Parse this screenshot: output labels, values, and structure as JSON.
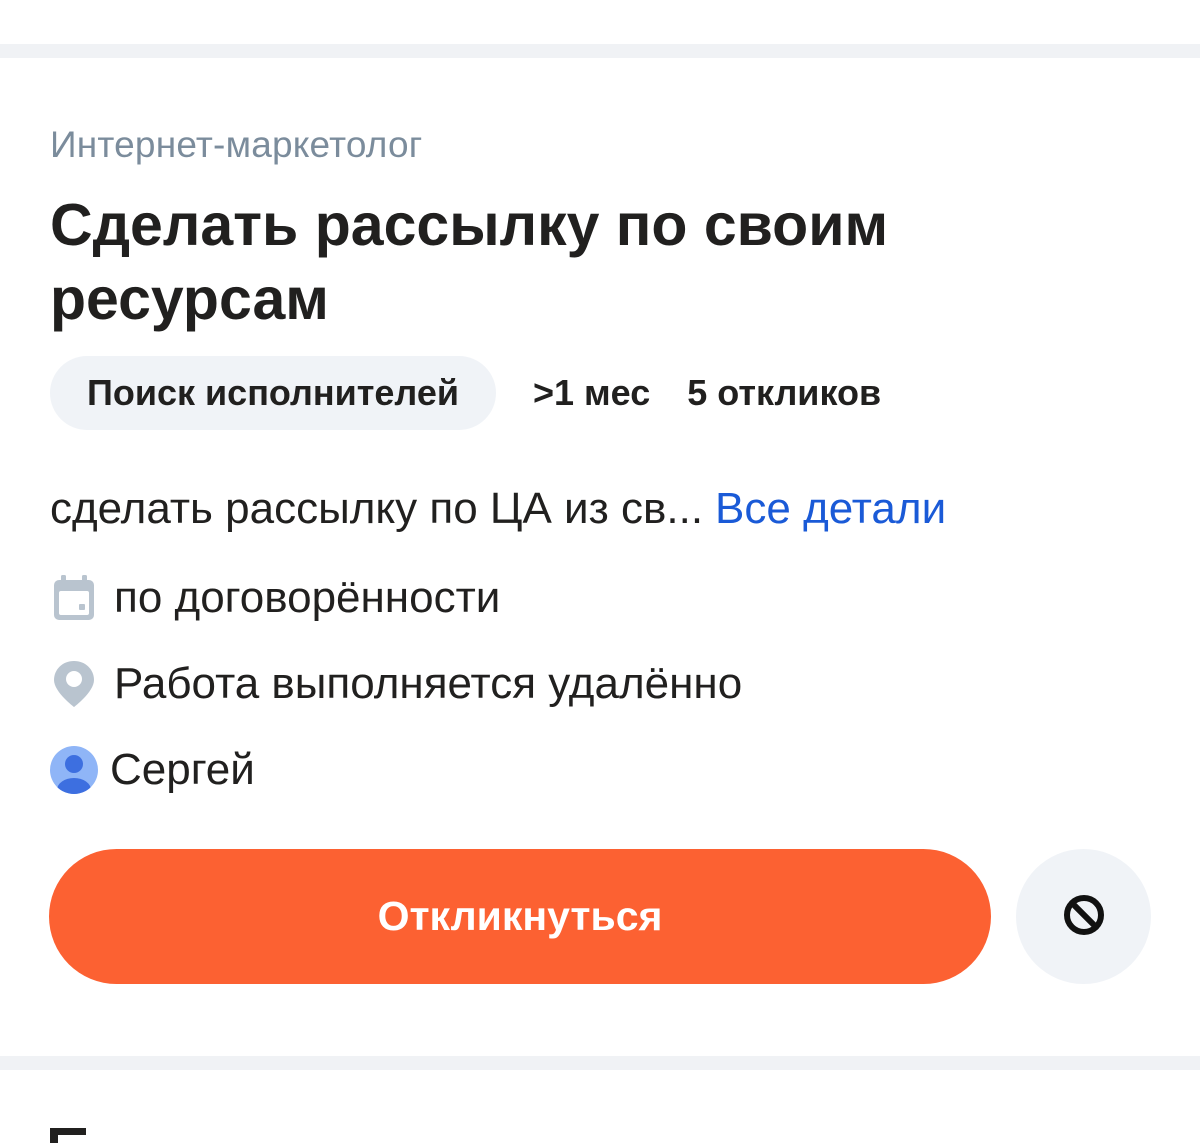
{
  "task": {
    "category": "Интернет-маркетолог",
    "title": "Сделать рассылку по своим ресурсам",
    "status": "Поиск исполнителей",
    "duration": ">1 мес",
    "responses": "5 откликов",
    "description_preview": "сделать рассылку по ЦА из св...",
    "details_link": "Все детали",
    "date": "по договорённости",
    "location": "Работа выполняется удалённо",
    "author": "Сергей"
  },
  "actions": {
    "respond_label": "Откликнуться"
  },
  "icons": {
    "date": "calendar-icon",
    "location": "location-pin-icon",
    "author": "user-avatar-icon",
    "hide": "block-icon"
  },
  "colors": {
    "accent": "#fc6132",
    "link": "#1a5ad7",
    "muted": "#7b8c9c",
    "badge_bg": "#f0f3f7",
    "avatar": "#5b8ff0"
  }
}
